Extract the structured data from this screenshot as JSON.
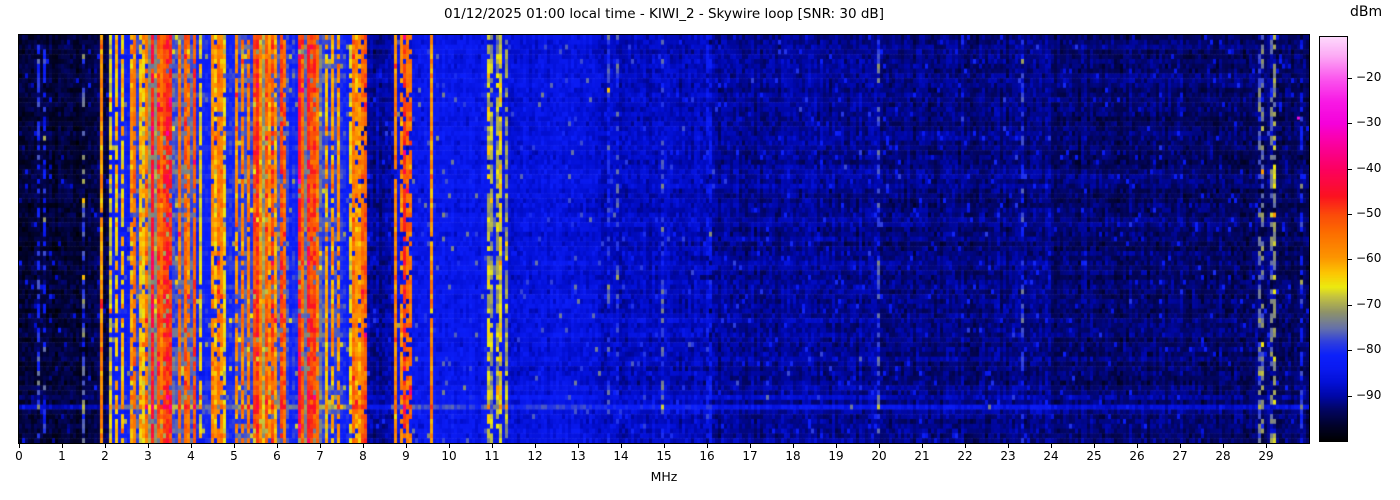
{
  "figure": {
    "title": "01/12/2025 01:00 local time - KIWI_2 - Skywire loop [SNR: 30 dB]",
    "xlabel": "MHz",
    "colorbar_label": "dBm"
  },
  "chart_data": {
    "type": "heatmap",
    "title": "01/12/2025 01:00 local time - KIWI_2 - Skywire loop [SNR: 30 dB]",
    "xlabel": "MHz",
    "ylabel": "",
    "x_range_mhz": [
      0,
      30
    ],
    "x_ticks": [
      0,
      1,
      2,
      3,
      4,
      5,
      6,
      7,
      8,
      9,
      10,
      11,
      12,
      13,
      14,
      15,
      16,
      17,
      18,
      19,
      20,
      21,
      22,
      23,
      24,
      25,
      26,
      27,
      28,
      29
    ],
    "grid": false,
    "legend": "colorbar right",
    "colorbar": {
      "label": "dBm",
      "vmax": -11,
      "vmin": -100,
      "tick_values": [
        -20,
        -30,
        -40,
        -50,
        -60,
        -70,
        -80,
        -90
      ],
      "tick_labels": [
        "−20",
        "−30",
        "−40",
        "−50",
        "−60",
        "−70",
        "−80",
        "−90"
      ]
    },
    "colormap_stops": [
      [
        -100,
        "#000000"
      ],
      [
        -96.5,
        "#01022a"
      ],
      [
        -93,
        "#020563"
      ],
      [
        -90,
        "#0007a8"
      ],
      [
        -87,
        "#0310d6"
      ],
      [
        -84,
        "#0a1af0"
      ],
      [
        -81,
        "#0c20fb"
      ],
      [
        -78,
        "#3040dd"
      ],
      [
        -75,
        "#6672a8"
      ],
      [
        -71.5,
        "#8f9368"
      ],
      [
        -68,
        "#c6c53e"
      ],
      [
        -66,
        "#ecea10"
      ],
      [
        -63,
        "#fcc703"
      ],
      [
        -59.5,
        "#fc9500"
      ],
      [
        -54,
        "#fc6d00"
      ],
      [
        -50,
        "#fb4a0a"
      ],
      [
        -46,
        "#fb1220"
      ],
      [
        -40,
        "#fc0060"
      ],
      [
        -36,
        "#fa008e"
      ],
      [
        -33,
        "#fa00b2"
      ],
      [
        -30,
        "#f501da"
      ],
      [
        -25,
        "#f81ae5"
      ],
      [
        -20,
        "#fb58ee"
      ],
      [
        -15,
        "#fcabf5"
      ],
      [
        -11,
        "#fdd8fc"
      ]
    ],
    "band_fields": [
      "f_start_mhz",
      "f_end_mhz",
      "floor_dbm",
      "carrier_density",
      "carrier_min_dbm",
      "carrier_max_dbm",
      "carrier_continuity"
    ],
    "bands": [
      [
        0.0,
        1.45,
        -95.5,
        0.05,
        -83,
        -77,
        0.5
      ],
      [
        1.45,
        1.56,
        -94.5,
        1.0,
        -78,
        -74,
        0.5
      ],
      [
        1.56,
        1.87,
        -94.5,
        0.1,
        -82,
        -76,
        0.5
      ],
      [
        1.87,
        1.96,
        -92.0,
        1.0,
        -59,
        -55,
        0.97
      ],
      [
        1.96,
        2.12,
        -95.0,
        0.06,
        -81,
        -77,
        0.5
      ],
      [
        2.12,
        2.6,
        -82.0,
        0.4,
        -68,
        -56,
        0.85
      ],
      [
        2.6,
        3.02,
        -79.0,
        0.55,
        -64,
        -52,
        0.88
      ],
      [
        3.02,
        3.5,
        -73.0,
        0.78,
        -56,
        -44,
        0.92
      ],
      [
        3.5,
        4.15,
        -76.0,
        0.7,
        -60,
        -46,
        0.9
      ],
      [
        4.15,
        4.6,
        -81.0,
        0.45,
        -67,
        -55,
        0.85
      ],
      [
        4.6,
        5.0,
        -80.0,
        0.5,
        -66,
        -54,
        0.85
      ],
      [
        5.0,
        5.45,
        -78.0,
        0.6,
        -62,
        -50,
        0.88
      ],
      [
        5.45,
        5.8,
        -70.0,
        0.82,
        -58,
        -46,
        0.94
      ],
      [
        5.8,
        6.3,
        -77.0,
        0.62,
        -60,
        -46,
        0.9
      ],
      [
        6.3,
        6.52,
        -81.0,
        0.4,
        -63,
        -50,
        0.88
      ],
      [
        6.52,
        7.05,
        -74.0,
        0.72,
        -56,
        -44,
        0.92
      ],
      [
        7.05,
        7.6,
        -79.0,
        0.52,
        -64,
        -52,
        0.86
      ],
      [
        7.6,
        7.72,
        -83.0,
        0.35,
        -71,
        -60,
        0.8
      ],
      [
        7.72,
        7.8,
        -83.0,
        1.0,
        -58,
        -54,
        0.95
      ],
      [
        7.8,
        7.87,
        -83.0,
        1.0,
        -61,
        -57,
        0.9
      ],
      [
        7.87,
        7.97,
        -84.0,
        0.3,
        -70,
        -60,
        0.8
      ],
      [
        7.97,
        8.06,
        -88.0,
        1.0,
        -55,
        -51,
        0.95
      ],
      [
        8.06,
        8.3,
        -90.5,
        0.08,
        -75,
        -65,
        0.3
      ],
      [
        8.3,
        8.4,
        -90.5,
        0.55,
        -62,
        -58,
        0.28
      ],
      [
        8.4,
        8.7,
        -90.5,
        0.08,
        -75,
        -65,
        0.3
      ],
      [
        8.7,
        8.78,
        -88.0,
        1.0,
        -60,
        -56,
        0.96
      ],
      [
        8.78,
        9.3,
        -85.0,
        0.65,
        -60,
        -46,
        0.74
      ],
      [
        9.3,
        9.45,
        -84.0,
        0.45,
        -66,
        -56,
        0.8
      ],
      [
        9.45,
        9.55,
        -85.0,
        0.12,
        -74,
        -66,
        0.6
      ],
      [
        9.55,
        9.63,
        -86.0,
        1.0,
        -60,
        -56,
        0.97
      ],
      [
        9.63,
        10.72,
        -84.5,
        0.09,
        -75,
        -67,
        0.6
      ],
      [
        10.72,
        11.35,
        -84.5,
        0.55,
        -74,
        -64,
        0.78
      ],
      [
        11.35,
        13.5,
        -86.0,
        0.04,
        -77,
        -71,
        0.5
      ],
      [
        13.5,
        16.0,
        -88.5,
        0.03,
        -79,
        -73,
        0.5
      ],
      [
        16.0,
        16.1,
        -89.5,
        1.0,
        -85,
        -82,
        0.7
      ],
      [
        16.1,
        20.0,
        -90.5,
        0.02,
        -80,
        -75,
        0.45
      ],
      [
        20.0,
        24.0,
        -91.5,
        0.012,
        -81,
        -77,
        0.45
      ],
      [
        24.0,
        28.82,
        -92.5,
        0.012,
        -82,
        -78,
        0.45
      ],
      [
        28.82,
        28.92,
        -92.5,
        1.0,
        -76,
        -72,
        0.5
      ],
      [
        28.92,
        29.12,
        -92.5,
        0.06,
        -82,
        -78,
        0.45
      ],
      [
        29.12,
        29.2,
        -92.5,
        1.0,
        -74,
        -70,
        0.55
      ],
      [
        29.2,
        30.0,
        -93.0,
        0.02,
        -82,
        -78,
        0.45
      ]
    ],
    "horizontal_lines": [
      {
        "row_frac": 0.884,
        "boost_db": 3
      },
      {
        "row_frac": 0.905,
        "boost_db": 6
      }
    ],
    "dots": [
      {
        "mhz": 29.72,
        "row_frac": 0.2,
        "dbm": -28
      }
    ],
    "noise_db": 3.2,
    "speckle_prob": 0.028,
    "rows": 85,
    "cols": 430,
    "seed": 20250112
  }
}
